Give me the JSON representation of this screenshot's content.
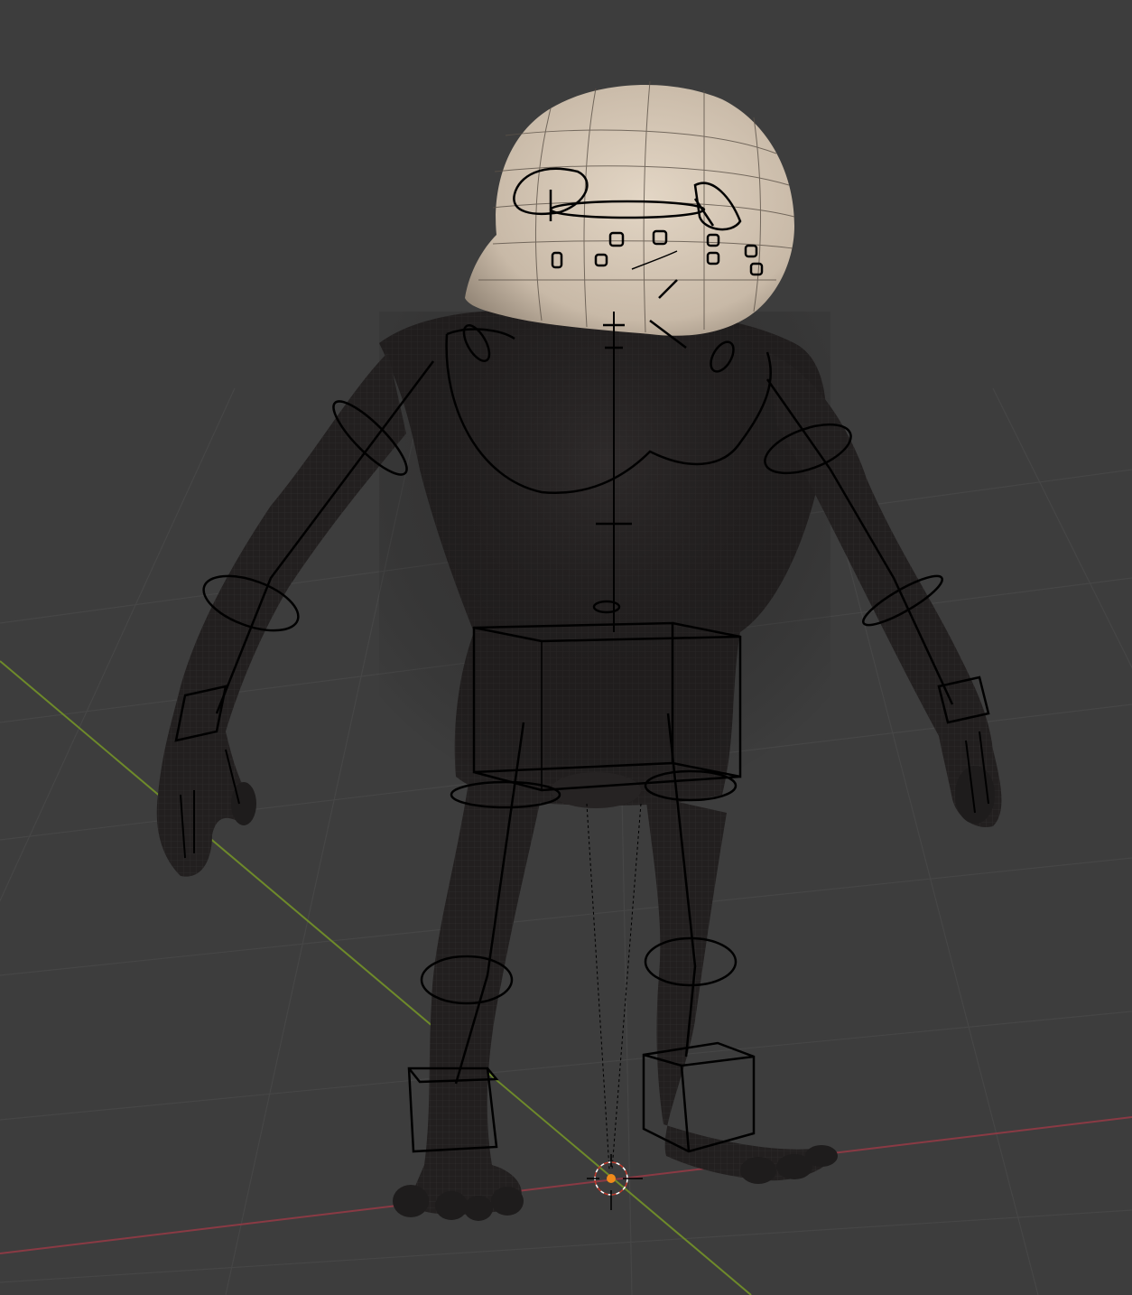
{
  "viewport": {
    "background": "#3d3d3d",
    "grid_color": "#464646",
    "x_axis_color": "#8a3a44",
    "y_axis_color": "#6e8a2a",
    "mesh_color": "#1f1d1d",
    "head_color": "#cdbfae",
    "rig_color": "#000000",
    "origin_color": "#f08a1a"
  },
  "scene": {
    "objects": [
      {
        "name_icon": "character-body-mesh"
      },
      {
        "name_icon": "character-head-mesh"
      },
      {
        "name_icon": "armature-rig"
      }
    ],
    "cursor_icon": "3d-cursor-icon"
  }
}
